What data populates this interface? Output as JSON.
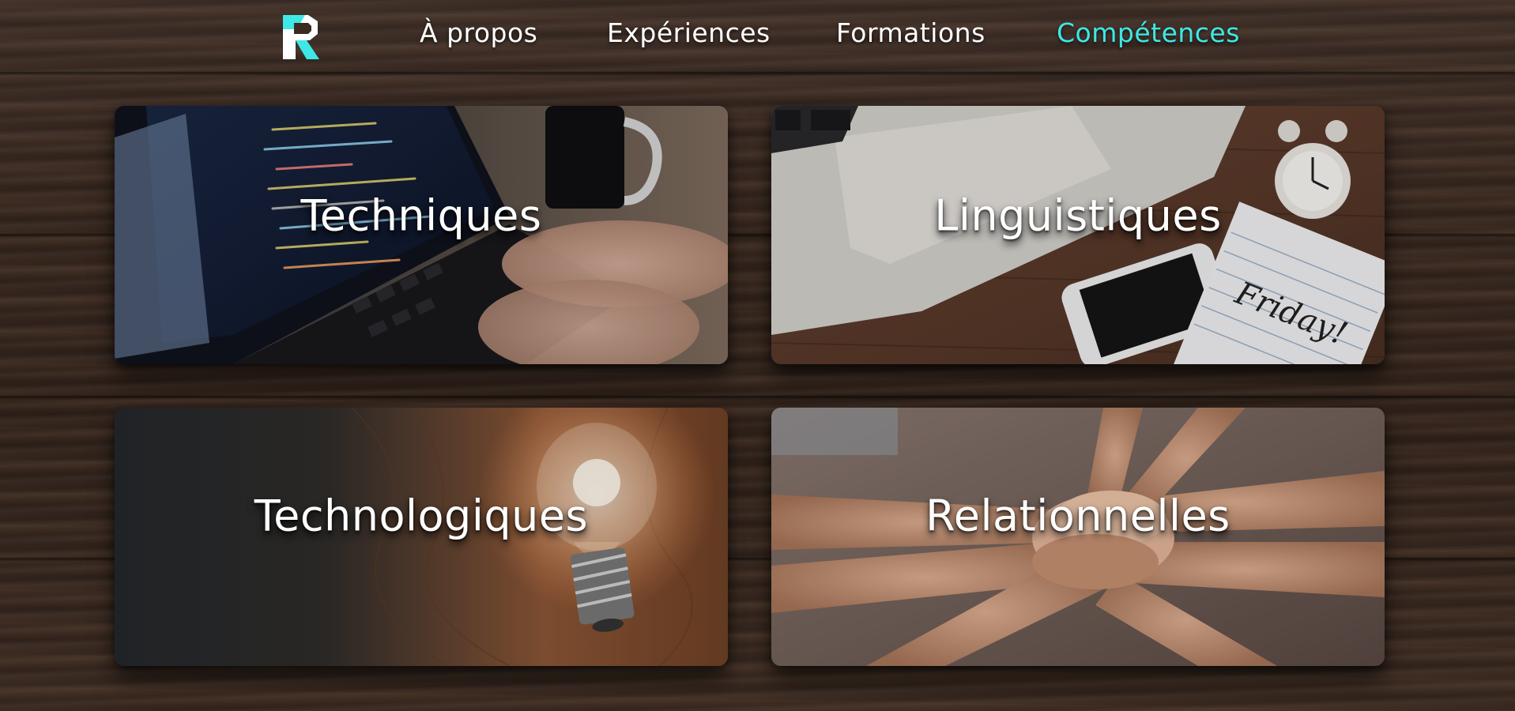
{
  "nav": {
    "logo_alt": "R",
    "items": [
      {
        "label": "À propos",
        "active": false
      },
      {
        "label": "Expériences",
        "active": false
      },
      {
        "label": "Formations",
        "active": false
      },
      {
        "label": "Compétences",
        "active": true
      }
    ]
  },
  "cards": [
    {
      "title": "Techniques",
      "image": "laptop-coding-photo"
    },
    {
      "title": "Linguistiques",
      "image": "desk-laptop-phone-clock-notebook-photo",
      "image_text": "Friday!"
    },
    {
      "title": "Technologiques",
      "image": "lightbulb-on-wood-photo"
    },
    {
      "title": "Relationnelles",
      "image": "stacked-hands-teamwork-photo"
    }
  ],
  "colors": {
    "accent": "#3ee8e6",
    "text": "#ffffff",
    "background": "#2e211a"
  }
}
